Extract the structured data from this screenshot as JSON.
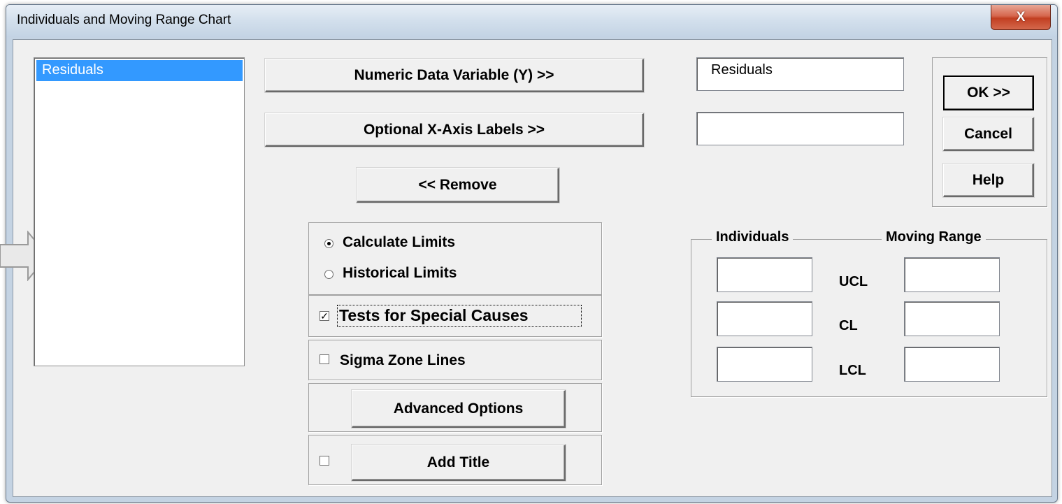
{
  "window": {
    "title": "Individuals and Moving Range Chart",
    "close_glyph": "X"
  },
  "variables_list": {
    "items": [
      "Residuals"
    ],
    "selected": "Residuals"
  },
  "buttons": {
    "numeric_y": "Numeric Data Variable (Y) >>",
    "x_axis": "Optional X-Axis Labels >>",
    "remove": "<< Remove",
    "ok": "OK >>",
    "cancel": "Cancel",
    "help": "Help",
    "advanced": "Advanced Options",
    "add_title": "Add Title"
  },
  "fields": {
    "numeric_y_value": "Residuals",
    "x_axis_value": ""
  },
  "limits": {
    "calculate": {
      "label": "Calculate Limits",
      "selected": true
    },
    "historical": {
      "label": "Historical Limits",
      "selected": false
    }
  },
  "options": {
    "tests_special_causes": {
      "label": "Tests for Special Causes",
      "checked": true
    },
    "sigma_zone_lines": {
      "label": "Sigma Zone Lines",
      "checked": false
    },
    "add_title_checked": false
  },
  "historical_frame": {
    "individuals_header": "Individuals",
    "moving_range_header": "Moving Range",
    "rows": [
      {
        "label": "UCL",
        "individuals": "",
        "moving_range": ""
      },
      {
        "label": "CL",
        "individuals": "",
        "moving_range": ""
      },
      {
        "label": "LCL",
        "individuals": "",
        "moving_range": ""
      }
    ]
  },
  "colors": {
    "selection": "#3399ff",
    "dialog_bg": "#f0f0f0",
    "close_red": "#c23f22"
  }
}
